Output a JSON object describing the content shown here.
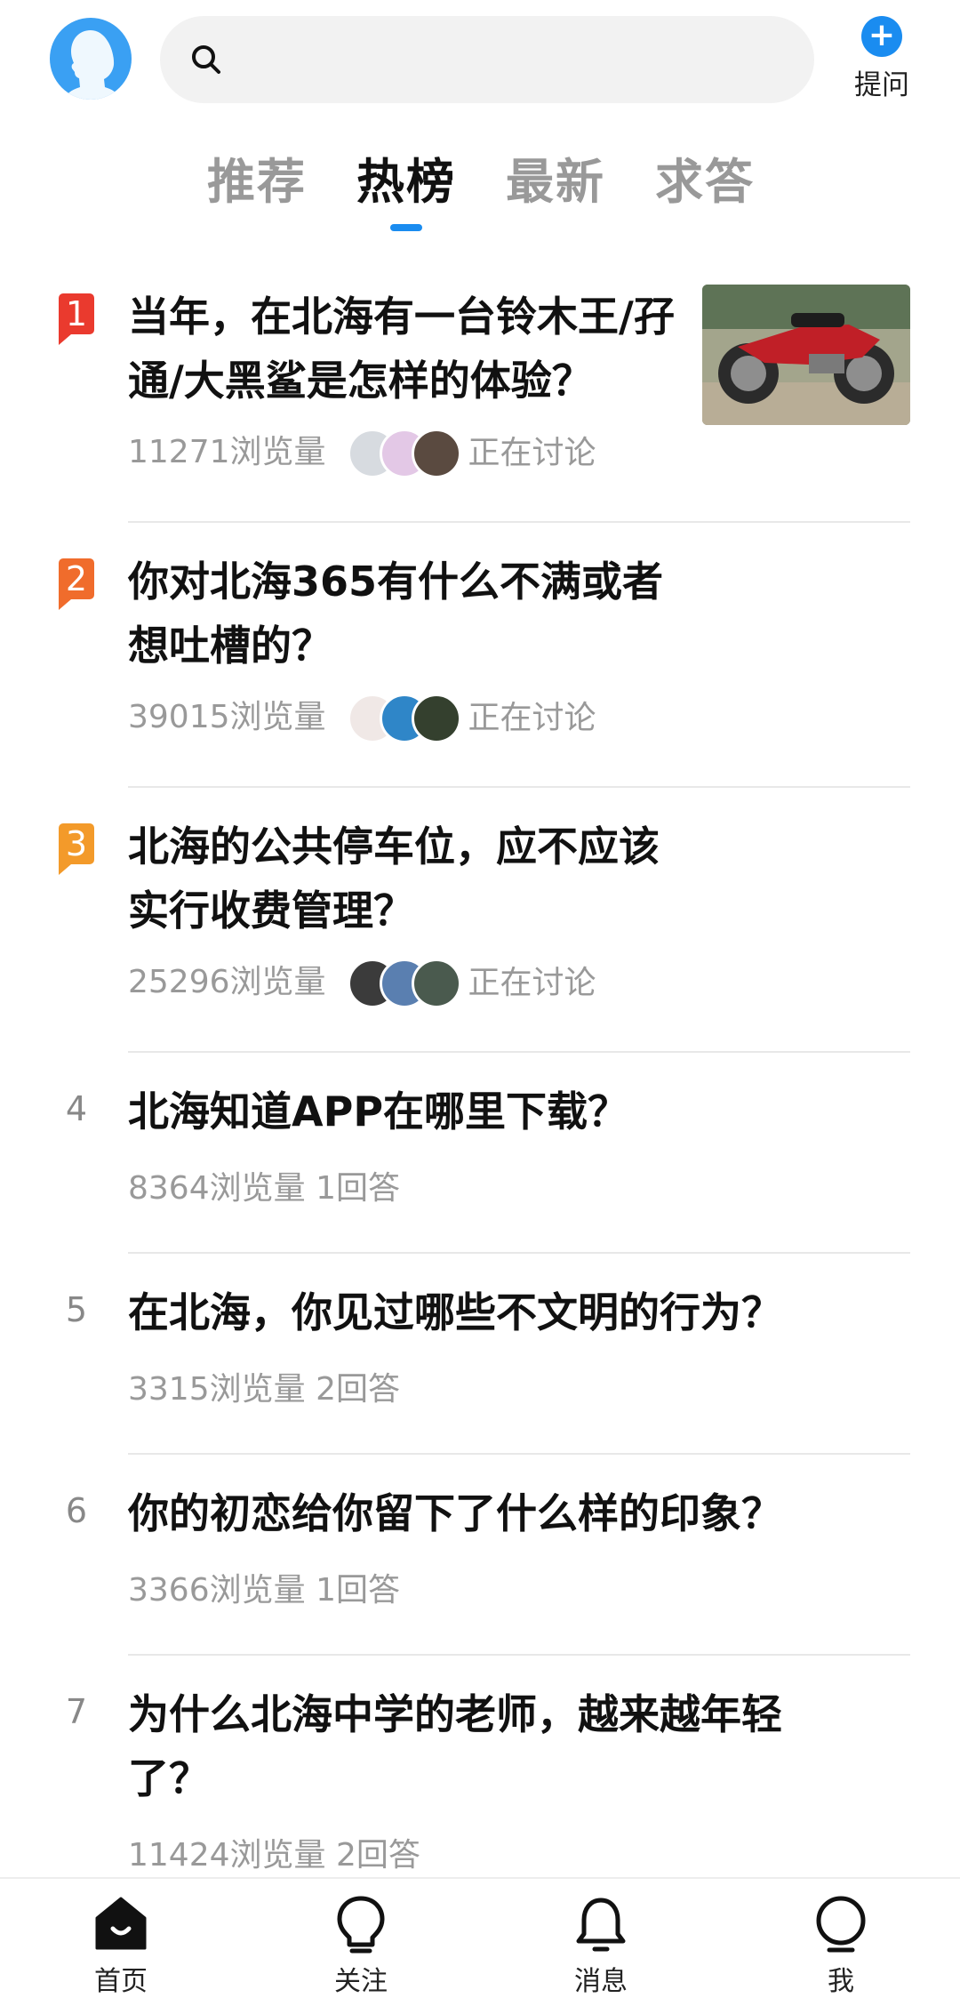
{
  "header": {
    "avatar_icon": "user-avatar-icon",
    "search_icon": "search-icon",
    "search_placeholder": "",
    "ask_label": "提问"
  },
  "tabs": [
    {
      "label": "推荐",
      "active": false
    },
    {
      "label": "热榜",
      "active": true
    },
    {
      "label": "最新",
      "active": false
    },
    {
      "label": "求答",
      "active": false
    }
  ],
  "list": [
    {
      "rank": "1",
      "title": "当年，在北海有一台铃木王/孖通/大黑鲨是怎样的体验？",
      "views": "11271浏览量",
      "status": "正在讨论",
      "has_image": true
    },
    {
      "rank": "2",
      "title": "你对北海365有什么不满或者想吐槽的？",
      "views": "39015浏览量",
      "status": "正在讨论",
      "has_image": false
    },
    {
      "rank": "3",
      "title": "北海的公共停车位，应不应该实行收费管理？",
      "views": "25296浏览量",
      "status": "正在讨论",
      "has_image": false
    },
    {
      "rank": "4",
      "title": "北海知道APP在哪里下载？",
      "views": "8364浏览量",
      "answers": "1回答"
    },
    {
      "rank": "5",
      "title": "在北海，你见过哪些不文明的行为？",
      "views": "3315浏览量",
      "answers": "2回答"
    },
    {
      "rank": "6",
      "title": "你的初恋给你留下了什么样的印象？",
      "views": "3366浏览量",
      "answers": "1回答"
    },
    {
      "rank": "7",
      "title": "为什么北海中学的老师，越来越年轻了？",
      "views": "11424浏览量",
      "answers": "2回答"
    }
  ],
  "bottom_nav": [
    {
      "label": "首页",
      "icon": "home-icon",
      "active": true
    },
    {
      "label": "关注",
      "icon": "lightbulb-icon",
      "active": false
    },
    {
      "label": "消息",
      "icon": "bell-icon",
      "active": false
    },
    {
      "label": "我",
      "icon": "profile-icon",
      "active": false
    }
  ],
  "colors": {
    "accent": "#1a8cf0",
    "rank1": "#ea3a2e",
    "rank2": "#f06c2c",
    "rank3": "#f39a2a",
    "muted": "#999999"
  }
}
